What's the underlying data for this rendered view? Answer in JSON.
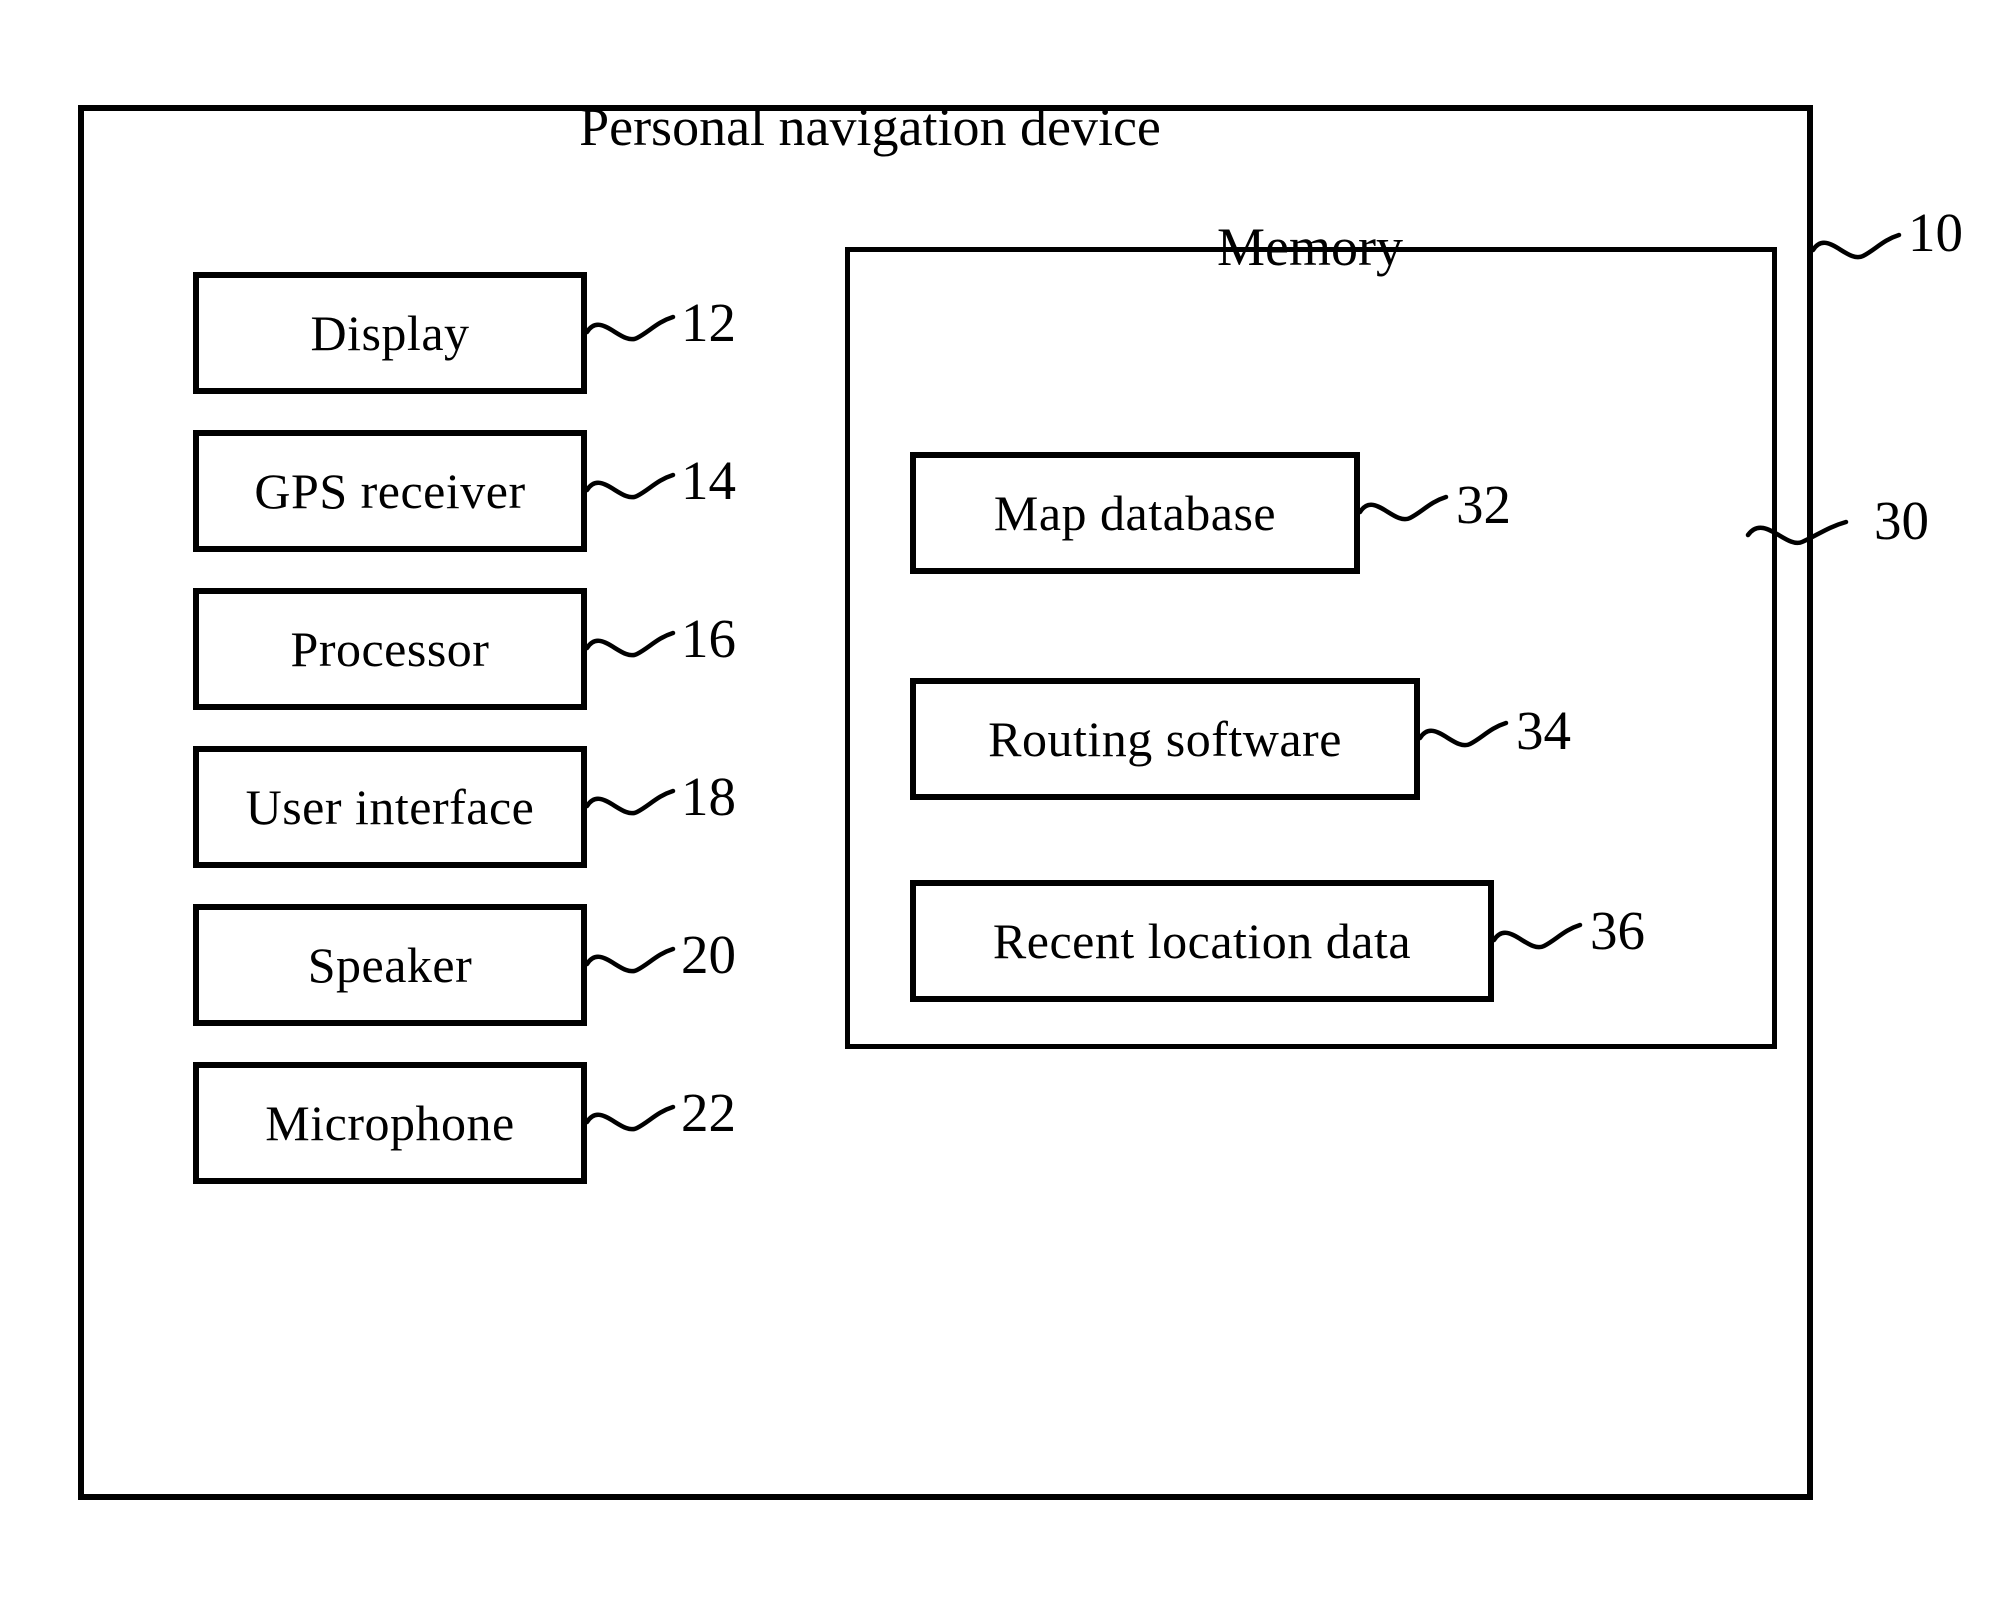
{
  "figure": {
    "title": "Personal navigation device",
    "outer_ref": "10",
    "memory_title": "Memory",
    "memory_ref": "30"
  },
  "components": [
    {
      "label": "Display",
      "ref": "12"
    },
    {
      "label": "GPS receiver",
      "ref": "14"
    },
    {
      "label": "Processor",
      "ref": "16"
    },
    {
      "label": "User interface",
      "ref": "18"
    },
    {
      "label": "Speaker",
      "ref": "20"
    },
    {
      "label": "Microphone",
      "ref": "22"
    }
  ],
  "memory_items": [
    {
      "label": "Map database",
      "ref": "32"
    },
    {
      "label": "Routing software",
      "ref": "34"
    },
    {
      "label": "Recent location data",
      "ref": "36"
    }
  ],
  "style": {
    "line_color": "#000000",
    "background": "#ffffff"
  }
}
